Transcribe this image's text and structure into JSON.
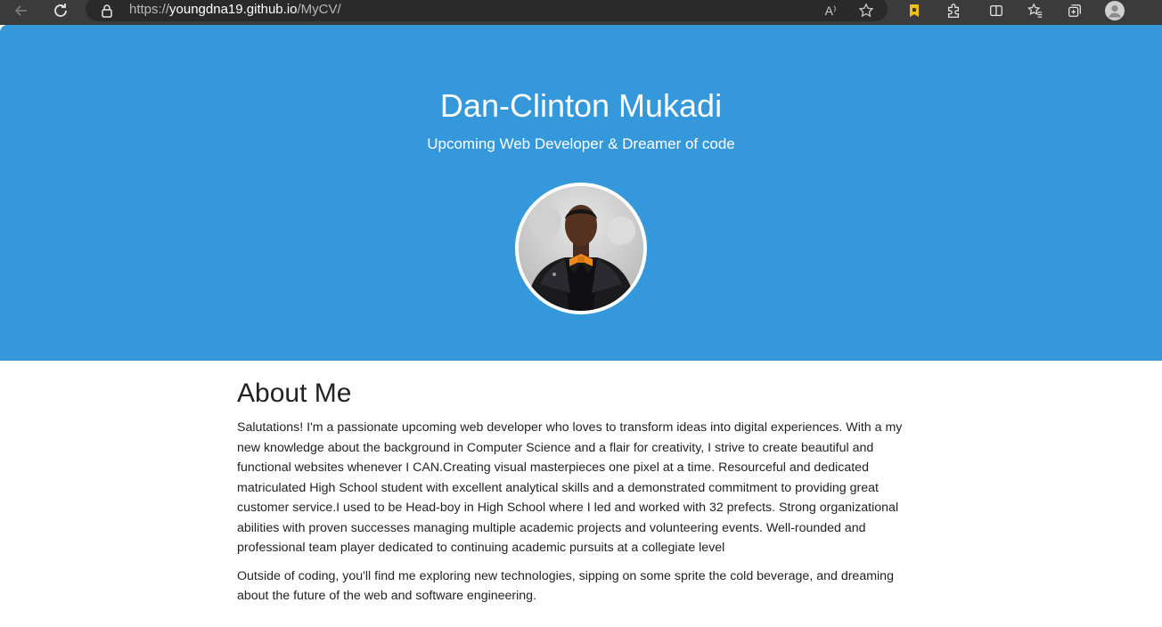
{
  "browser": {
    "url_scheme": "https://",
    "url_host": "youngdna19.github.io",
    "url_path": "/MyCV/",
    "read_aloud_label": "A⁾",
    "icons": [
      "back-icon",
      "refresh-icon",
      "lock-icon",
      "read-aloud-icon",
      "favorite-star-icon",
      "extension-badge-icon",
      "extensions-icon",
      "split-screen-icon",
      "favorites-icon",
      "collections-icon",
      "profile-icon"
    ]
  },
  "hero": {
    "name": "Dan-Clinton Mukadi",
    "tagline": "Upcoming Web Developer & Dreamer of code"
  },
  "about": {
    "heading": "About Me",
    "paragraph1": "Salutations! I'm a passionate upcoming web developer who loves to transform ideas into digital experiences. With a my new knowledge about the background in Computer Science and a flair for creativity, I strive to create beautiful and functional websites whenever I CAN.Creating visual masterpieces one pixel at a time. Resourceful and dedicated matriculated High School student with excellent analytical skills and a demonstrated commitment to providing great customer service.I used to be Head-boy in High School where I led and worked with 32 prefects. Strong organizational abilities with proven successes managing multiple academic projects and volunteering events. Well-rounded and professional team player dedicated to continuing academic pursuits at a collegiate level",
    "paragraph2": "Outside of coding, you'll find me exploring new technologies, sipping on some sprite the cold beverage, and dreaming about the future of the web and software engineering."
  },
  "colors": {
    "hero_background": "#3498db",
    "hero_text": "#ffffff",
    "body_text": "#222222",
    "browser_chrome": "#3b3b3b",
    "bowtie": "#f08a1c"
  }
}
